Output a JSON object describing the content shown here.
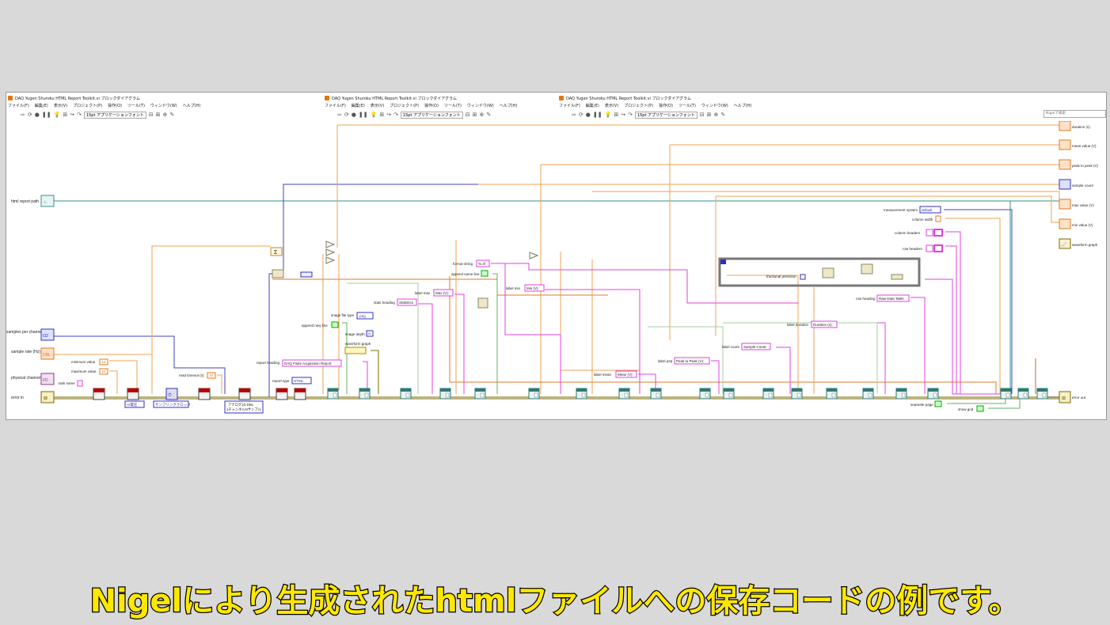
{
  "windows": [
    {
      "title": "DAQ Yugen Shuroku HTML Report Toolkit.vi ブロックダイアグラム"
    },
    {
      "title": "DAQ Yugen Shuroku HTML Report Toolkit.vi ブロックダイアグラム"
    },
    {
      "title": "DAQ Yugen Shuroku HTML Report Toolkit.vi ブロックダイアグラム"
    }
  ],
  "menu": [
    "ファイル(F)",
    "編集(E)",
    "表示(V)",
    "プロジェクト(P)",
    "操作(O)",
    "ツール(T)",
    "ウィンドウ(W)",
    "ヘルプ(H)"
  ],
  "toolbar": {
    "font_select": "15pt アプリケーションフォント"
  },
  "search_placeholder": "Nigelで検索",
  "left_controls": {
    "html_report_path": "html report path",
    "samples_per_channel": "samples per channel",
    "sample_rate": "sample rate (Hz)",
    "physical_channel": "physical channel",
    "error_in": "error in"
  },
  "constants": {
    "minimum_value": "minimum value",
    "minimum_value_num": "-10",
    "maximum_value": "maximum value",
    "maximum_value_num": "10",
    "task_name": "task name",
    "ai_voltage": "AI電圧",
    "sample_clock": "サンプリングクロック",
    "read_timeout": "read timeout (s)",
    "read_timeout_num": "10",
    "analog_1d": "アナログ1D DBL",
    "analog_1d_sub": "1チャンネルNサンプル",
    "report_heading": "report heading",
    "report_heading_val": "DAQ Finite Acquisition Report",
    "report_type": "report type",
    "report_type_val": "HTML",
    "image_file_type": "image file type",
    "image_file_type_val": ".png",
    "append_new_line": "append new line",
    "image_depth": "image depth",
    "image_depth_val": "24",
    "waveform_graph_const": "waveform graph",
    "stats_heading": "stats heading",
    "stats_heading_val": "Statistics",
    "label_max": "label max",
    "label_max_val": "Max (V):",
    "format_string": "format string",
    "format_string_val": "%.4f",
    "append_same_line": "append same line",
    "label_min": "label min",
    "label_min_val": "Min (V):",
    "label_mean": "label mean",
    "label_mean_val": "Mean (V):",
    "label_p2p": "label p2p",
    "label_p2p_val": "Peak to Peak (V):",
    "label_count": "label count",
    "label_count_val": "Sample Count:",
    "label_duration": "label duration",
    "label_duration_val": "Duration (s):",
    "fractional_precision": "fractional precision",
    "row_heading": "row heading",
    "row_heading_val": "Raw Data Table",
    "measurement_system": "measurement system",
    "measurement_system_val": "default",
    "column_width": "column width",
    "column_headers": "column headers",
    "row_headers": "row headers",
    "separate_page": "separate page",
    "show_grid": "show grid"
  },
  "right_indicators": {
    "duration": "duration (s)",
    "mean_value": "mean value (V)",
    "peak_to_peak": "peak to peak (V)",
    "sample_count": "sample count",
    "max_value": "max value (V)",
    "min_value": "min value (V)",
    "waveform_graph": "waveform graph",
    "error_out": "error out"
  },
  "caption": "Nigelにより生成されたhtmlファイルへの保存コードの例です。"
}
